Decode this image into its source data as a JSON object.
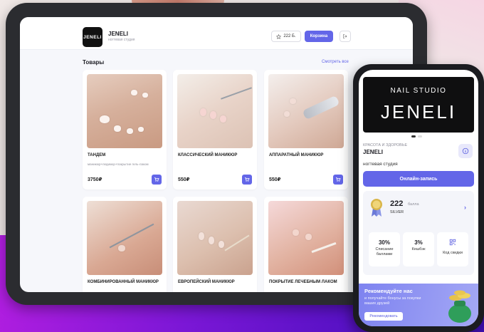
{
  "header": {
    "logo_text": "JENELI",
    "brand_name": "JENELI",
    "brand_subtitle": "ногтевая студия",
    "points_label": "222 Б.",
    "cart_label": "Корзина",
    "star_icon": "star-icon",
    "exit_icon": "logout-icon"
  },
  "catalog": {
    "title": "Товары",
    "see_all": "Смотреть все",
    "products": [
      {
        "name": "ТАНДЕМ",
        "description": "маникюр+педикюр+покрытие гель-лаком",
        "price": "3750₽"
      },
      {
        "name": "КЛАССИЧЕСКИЙ МАНИКЮР",
        "description": "",
        "price": "550₽"
      },
      {
        "name": "АППАРАТНЫЙ МАНИКЮР",
        "description": "",
        "price": "550₽"
      },
      {
        "name": "КОМБИНИРОВАННЫЙ МАНИКЮР",
        "description": "",
        "price": ""
      },
      {
        "name": "ЕВРОПЕЙСКИЙ МАНИКЮР",
        "description": "",
        "price": ""
      },
      {
        "name": "ПОКРЫТИЕ ЛЕЧЕБНЫМ ЛАКОМ",
        "description": "",
        "price": ""
      }
    ]
  },
  "phone": {
    "banner_line1": "NAIL STUDIO",
    "banner_line2": "JENELI",
    "category": "КРАСОТА И ЗДОРОВЬЕ",
    "name": "JENELI",
    "subtitle": "ногтевая студия",
    "book_button": "Онлайн-запись",
    "loyalty": {
      "points": "222",
      "points_label": "балла",
      "level": "SILVER",
      "tiles": [
        {
          "value": "30%",
          "label": "Списание баллами"
        },
        {
          "value": "3%",
          "label": "Кешбэк"
        },
        {
          "value": "",
          "label": "Код скидки"
        }
      ]
    },
    "referral": {
      "title": "Рекомендуйте нас",
      "text": "и получайте бонусы за покупки ваших друзей",
      "button": "Рекомендовать"
    }
  },
  "colors": {
    "accent": "#6366e8",
    "background_purple": "#7b17d6"
  }
}
